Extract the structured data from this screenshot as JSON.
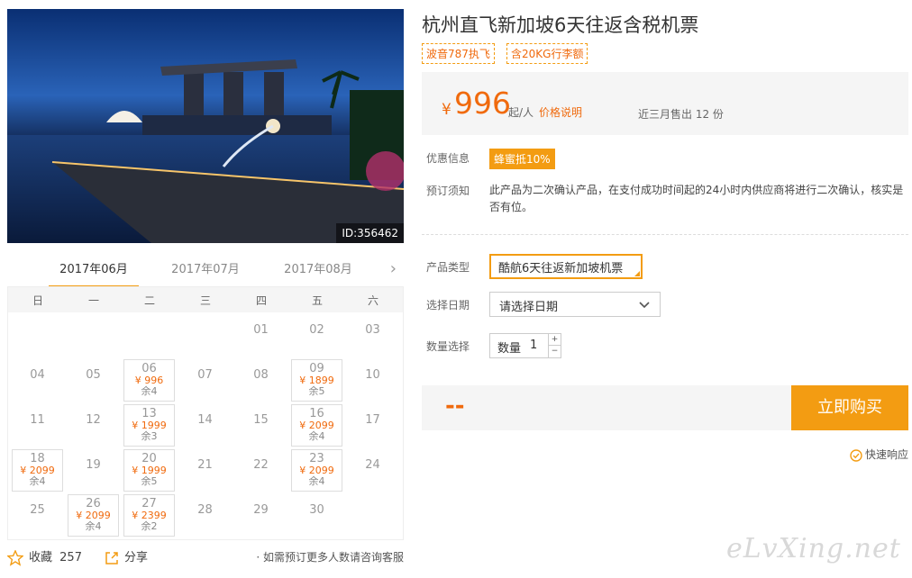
{
  "hero": {
    "image_id": "ID:356462"
  },
  "months": {
    "tabs": [
      "2017年06月",
      "2017年07月",
      "2017年08月"
    ],
    "next": "›"
  },
  "calendar": {
    "weekdays": [
      "日",
      "一",
      "二",
      "三",
      "四",
      "五",
      "六"
    ],
    "days": [
      {
        "day": "01"
      },
      {
        "day": "02"
      },
      {
        "day": "03"
      },
      {
        "day": "04"
      },
      {
        "day": "05"
      },
      {
        "day": "06",
        "price": "¥ 996",
        "stock": "余4"
      },
      {
        "day": "07"
      },
      {
        "day": "08"
      },
      {
        "day": "09",
        "price": "¥ 1899",
        "stock": "余5"
      },
      {
        "day": "10"
      },
      {
        "day": "11"
      },
      {
        "day": "12"
      },
      {
        "day": "13",
        "price": "¥ 1999",
        "stock": "余3"
      },
      {
        "day": "14"
      },
      {
        "day": "15"
      },
      {
        "day": "16",
        "price": "¥ 2099",
        "stock": "余4"
      },
      {
        "day": "17"
      },
      {
        "day": "18",
        "price": "¥ 2099",
        "stock": "余4"
      },
      {
        "day": "19"
      },
      {
        "day": "20",
        "price": "¥ 1999",
        "stock": "余5"
      },
      {
        "day": "21"
      },
      {
        "day": "22"
      },
      {
        "day": "23",
        "price": "¥ 2099",
        "stock": "余4"
      },
      {
        "day": "24"
      },
      {
        "day": "25"
      },
      {
        "day": "26",
        "price": "¥ 2099",
        "stock": "余4"
      },
      {
        "day": "27",
        "price": "¥ 2399",
        "stock": "余2"
      },
      {
        "day": "28"
      },
      {
        "day": "29"
      },
      {
        "day": "30"
      }
    ]
  },
  "footer": {
    "fav_label": "收藏",
    "fav_count": "257",
    "share_label": "分享",
    "consult": "· 如需预订更多人数请咨询客服"
  },
  "product": {
    "title": "杭州直飞新加坡6天往返含税机票",
    "tags": [
      "波音787执飞",
      "含20KG行李额"
    ],
    "price": {
      "symbol": "¥",
      "value": "996",
      "unit": "起/人",
      "link": "价格说明",
      "sold": "近三月售出 12 份"
    },
    "promo_label": "优惠信息",
    "promo_badge": "蜂蜜抵10%",
    "notice_label": "预订须知",
    "notice_text": "此产品为二次确认产品，在支付成功时间起的24小时内供应商将进行二次确认，核实是否有位。",
    "type_label": "产品类型",
    "type_value": "酷航6天往返新加坡机票",
    "date_label": "选择日期",
    "date_value": "请选择日期",
    "qty_label": "数量选择",
    "qty_inner": "数量",
    "qty_value": "1",
    "qty_up": "+",
    "qty_down": "−",
    "total": "--",
    "buy": "立即购买",
    "quick": "快速响应"
  },
  "watermark": "eLvXing.net",
  "colors": {
    "accent": "#f39c12",
    "price": "#f06a0d",
    "panel": "#f5f5f5"
  }
}
